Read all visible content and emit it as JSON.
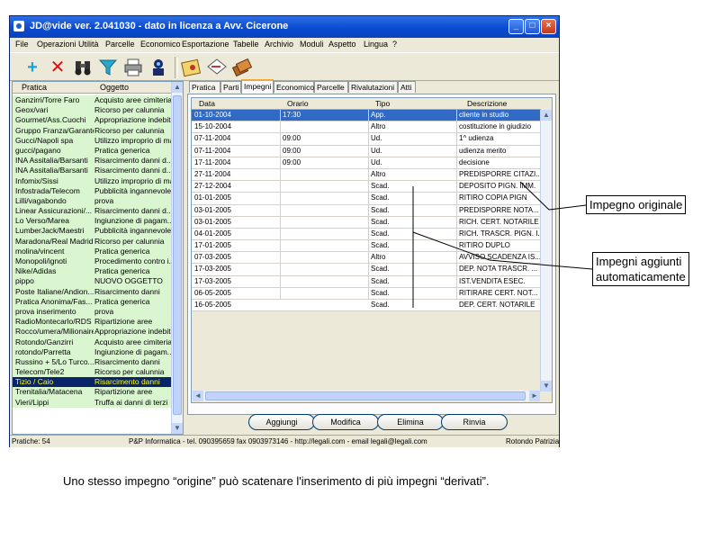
{
  "window": {
    "title": "JD@vide ver. 2.041030 - dato in licenza a Avv. Cicerone"
  },
  "menu": [
    "File",
    "Operazioni",
    "Utilità",
    "Parcelle",
    "Economico",
    "Esportazione",
    "Tabelle",
    "Archivio",
    "Moduli",
    "Aspetto",
    "Lingua",
    "?"
  ],
  "toolbar": {
    "icons": [
      "add-icon",
      "delete-icon",
      "search-binoculars-icon",
      "filter-funnel-icon",
      "print-icon",
      "person-search-icon",
      "calendar-icon",
      "document-edit-icon",
      "books-icon"
    ]
  },
  "left_list": {
    "headers": [
      "Pratica",
      "Oggetto"
    ],
    "rows": [
      [
        "Ganzirri/Torre Faro",
        "Acquisto aree cimiteriali"
      ],
      [
        "Geox/vari",
        "Ricorso per calunnia"
      ],
      [
        "Gourmet/Ass.Cuochi",
        "Appropriazione indebita"
      ],
      [
        "Gruppo Franza/Garante",
        "Ricorso per calunnia"
      ],
      [
        "Gucci/Napoli spa",
        "Utilizzo improprio di mar..."
      ],
      [
        "gucci/pagano",
        "Pratica generica"
      ],
      [
        "INA Assitalia/Barsanti",
        "Risarcimento danni d..."
      ],
      [
        "INA Assitalia/Barsanti",
        "Risarcimento danni d..."
      ],
      [
        "Infomix/Sissi",
        "Utilizzo improprio di mar..."
      ],
      [
        "Infostrada/Telecom",
        "Pubblicità ingannevole"
      ],
      [
        "Lilli/vagabondo",
        "prova"
      ],
      [
        "Linear Assicurazioni/...",
        "Risarcimento danni d..."
      ],
      [
        "Lo Verso/Marea",
        "Ingiunzione di pagam..."
      ],
      [
        "LumberJack/Maestri",
        "Pubblicità ingannevole"
      ],
      [
        "Maradona/Real Madrid",
        "Ricorso per calunnia"
      ],
      [
        "molina/vincent",
        "Pratica generica"
      ],
      [
        "Monopoli/ignoti",
        "Procedimento contro i..."
      ],
      [
        "Nike/Adidas",
        "Pratica generica"
      ],
      [
        "pippo",
        "NUOVO OGGETTO"
      ],
      [
        "Poste Italiane/Andion...",
        "Risarcimento danni"
      ],
      [
        "Pratica Anonima/Fas...",
        "Pratica generica"
      ],
      [
        "prova inserimento",
        "prova"
      ],
      [
        "RadioMontecarlo/RDS",
        "Ripartizione aree"
      ],
      [
        "Rocco/umera/Milionaire",
        "Appropriazione indebita"
      ],
      [
        "Rotondo/Ganzirri",
        "Acquisto aree cimiteriali"
      ],
      [
        "rotondo/Parretta",
        "Ingiunzione di pagam..."
      ],
      [
        "Russino + 5/Lo Turco...",
        "Risarcimento danni"
      ],
      [
        "Telecom/Tele2",
        "Ricorso per calunnia"
      ],
      [
        "Tizio / Caio",
        "Risarcimento danni"
      ],
      [
        "Trenitalia/Matacena",
        "Ripartizione aree"
      ],
      [
        "Vieri/Lippi",
        "Truffa ai danni di terzi"
      ]
    ],
    "selected_index": 28
  },
  "tabs": [
    "Pratica",
    "Parti",
    "Impegni",
    "Economico",
    "Parcelle",
    "Rivalutazioni",
    "Atti"
  ],
  "active_tab": "Impegni",
  "grid": {
    "headers": [
      "Data",
      "Orario",
      "Tipo",
      "Descrizione"
    ],
    "rows": [
      [
        "01-10-2004",
        "17:30",
        "App.",
        "cliente in studio"
      ],
      [
        "15-10-2004",
        "",
        "Altro",
        "costituzione in giudizio"
      ],
      [
        "07-11-2004",
        "09:00",
        "Ud.",
        "1^ udienza"
      ],
      [
        "07-11-2004",
        "09:00",
        "Ud.",
        "udienza merito"
      ],
      [
        "17-11-2004",
        "09:00",
        "Ud.",
        "decisione"
      ],
      [
        "27-11-2004",
        "",
        "Altro",
        "PREDISPORRE CITAZI..."
      ],
      [
        "27-12-2004",
        "",
        "Scad.",
        "DEPOSITO PIGN. IMM."
      ],
      [
        "01-01-2005",
        "",
        "Scad.",
        "RITIRO COPIA PIGN"
      ],
      [
        "03-01-2005",
        "",
        "Scad.",
        "PREDISPORRE NOTA..."
      ],
      [
        "03-01-2005",
        "",
        "Scad.",
        "RICH. CERT. NOTARILE"
      ],
      [
        "04-01-2005",
        "",
        "Scad.",
        "RICH. TRASCR. PIGN. I..."
      ],
      [
        "17-01-2005",
        "",
        "Scad.",
        "RITIRO DUPLO"
      ],
      [
        "07-03-2005",
        "",
        "Altro",
        "AVVISO SCADENZA IS..."
      ],
      [
        "17-03-2005",
        "",
        "Scad.",
        "DEP. NOTA TRASCR. ..."
      ],
      [
        "17-03-2005",
        "",
        "Scad.",
        "IST.VENDITA ESEC."
      ],
      [
        "06-05-2005",
        "",
        "Scad.",
        "RITIRARE CERT. NOT..."
      ],
      [
        "16-05-2005",
        "",
        "Scad.",
        "DEP. CERT. NOTARILE"
      ]
    ],
    "selected_index": 0
  },
  "buttons": {
    "add": "Aggiungi",
    "edit": "Modifica",
    "delete": "Elimina",
    "postpone": "Rinvia"
  },
  "status": {
    "count": "Pratiche: 54",
    "info": "P&P Informatica - tel. 090395659 fax 0903973146 - http://legali.com - email legali@legali.com",
    "user": "Rotondo Patrizia"
  },
  "annotations": {
    "original": "Impegno originale",
    "added_line1": "Impegni aggiunti",
    "added_line2": "automaticamente"
  },
  "caption": "Uno stesso impegno “origine” può scatenare l'inserimento di più impegni “derivati”."
}
